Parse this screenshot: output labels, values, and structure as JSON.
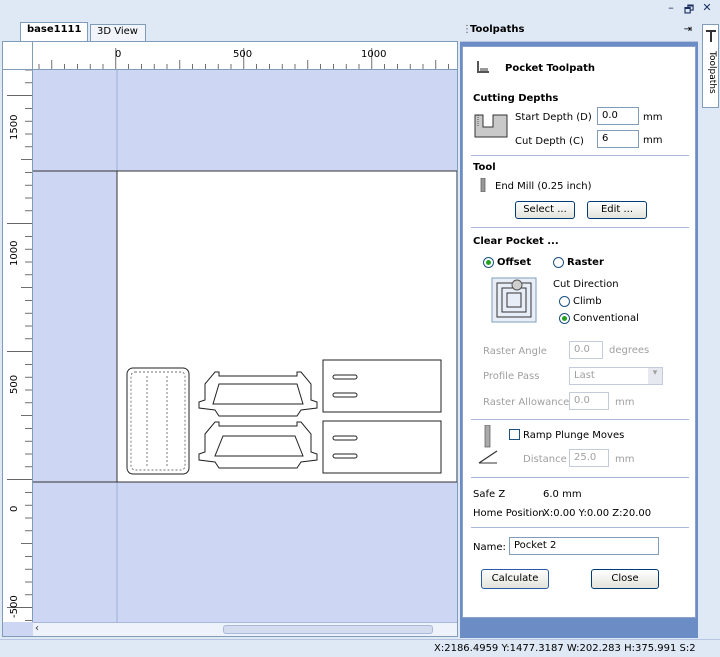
{
  "window": {
    "minimize": "–",
    "restore": "🗗",
    "close": "✕"
  },
  "tabs": [
    {
      "label": "base1111",
      "active": true
    },
    {
      "label": "3D View",
      "active": false
    }
  ],
  "rulers": {
    "horizontal": [
      "0",
      "500",
      "1000"
    ],
    "vertical": [
      "1500",
      "1000",
      "500",
      "0",
      "-500"
    ]
  },
  "panel": {
    "title": "Toolpaths",
    "pin": "⇥",
    "heading": "Pocket Toolpath",
    "cutting_depths": {
      "label": "Cutting Depths",
      "start_depth_label": "Start Depth (D)",
      "start_depth_value": "0.0",
      "cut_depth_label": "Cut Depth (C)",
      "cut_depth_value": "6",
      "unit": "mm"
    },
    "tool": {
      "label": "Tool",
      "name": "End Mill (0.25 inch)",
      "select_button": "Select ...",
      "edit_button": "Edit ..."
    },
    "clear_pocket": {
      "label": "Clear Pocket ...",
      "offset_label": "Offset",
      "raster_label": "Raster",
      "selected_strategy": "offset",
      "cut_direction_label": "Cut Direction",
      "climb_label": "Climb",
      "conventional_label": "Conventional",
      "selected_direction": "conventional",
      "raster_angle_label": "Raster Angle",
      "raster_angle_value": "0.0",
      "raster_angle_unit": "degrees",
      "profile_pass_label": "Profile Pass",
      "profile_pass_value": "Last",
      "raster_allowance_label": "Raster Allowance",
      "raster_allowance_value": "0.0",
      "raster_allowance_unit": "mm"
    },
    "ramp": {
      "checkbox_label": "Ramp Plunge Moves",
      "checked": false,
      "distance_label": "Distance",
      "distance_value": "25.0",
      "distance_unit": "mm"
    },
    "safe_z_label": "Safe Z",
    "safe_z_value": "6.0 mm",
    "home_position_label": "Home Position",
    "home_position_value": "X:0.00 Y:0.00 Z:20.00",
    "name_label": "Name:",
    "name_value": "Pocket 2",
    "calculate_button": "Calculate",
    "close_button": "Close"
  },
  "side_tab": {
    "label": "Toolpaths"
  },
  "status_bar": {
    "text": "X:2186.4959 Y:1477.3187   W:202.283   H:375.991  S:2"
  }
}
